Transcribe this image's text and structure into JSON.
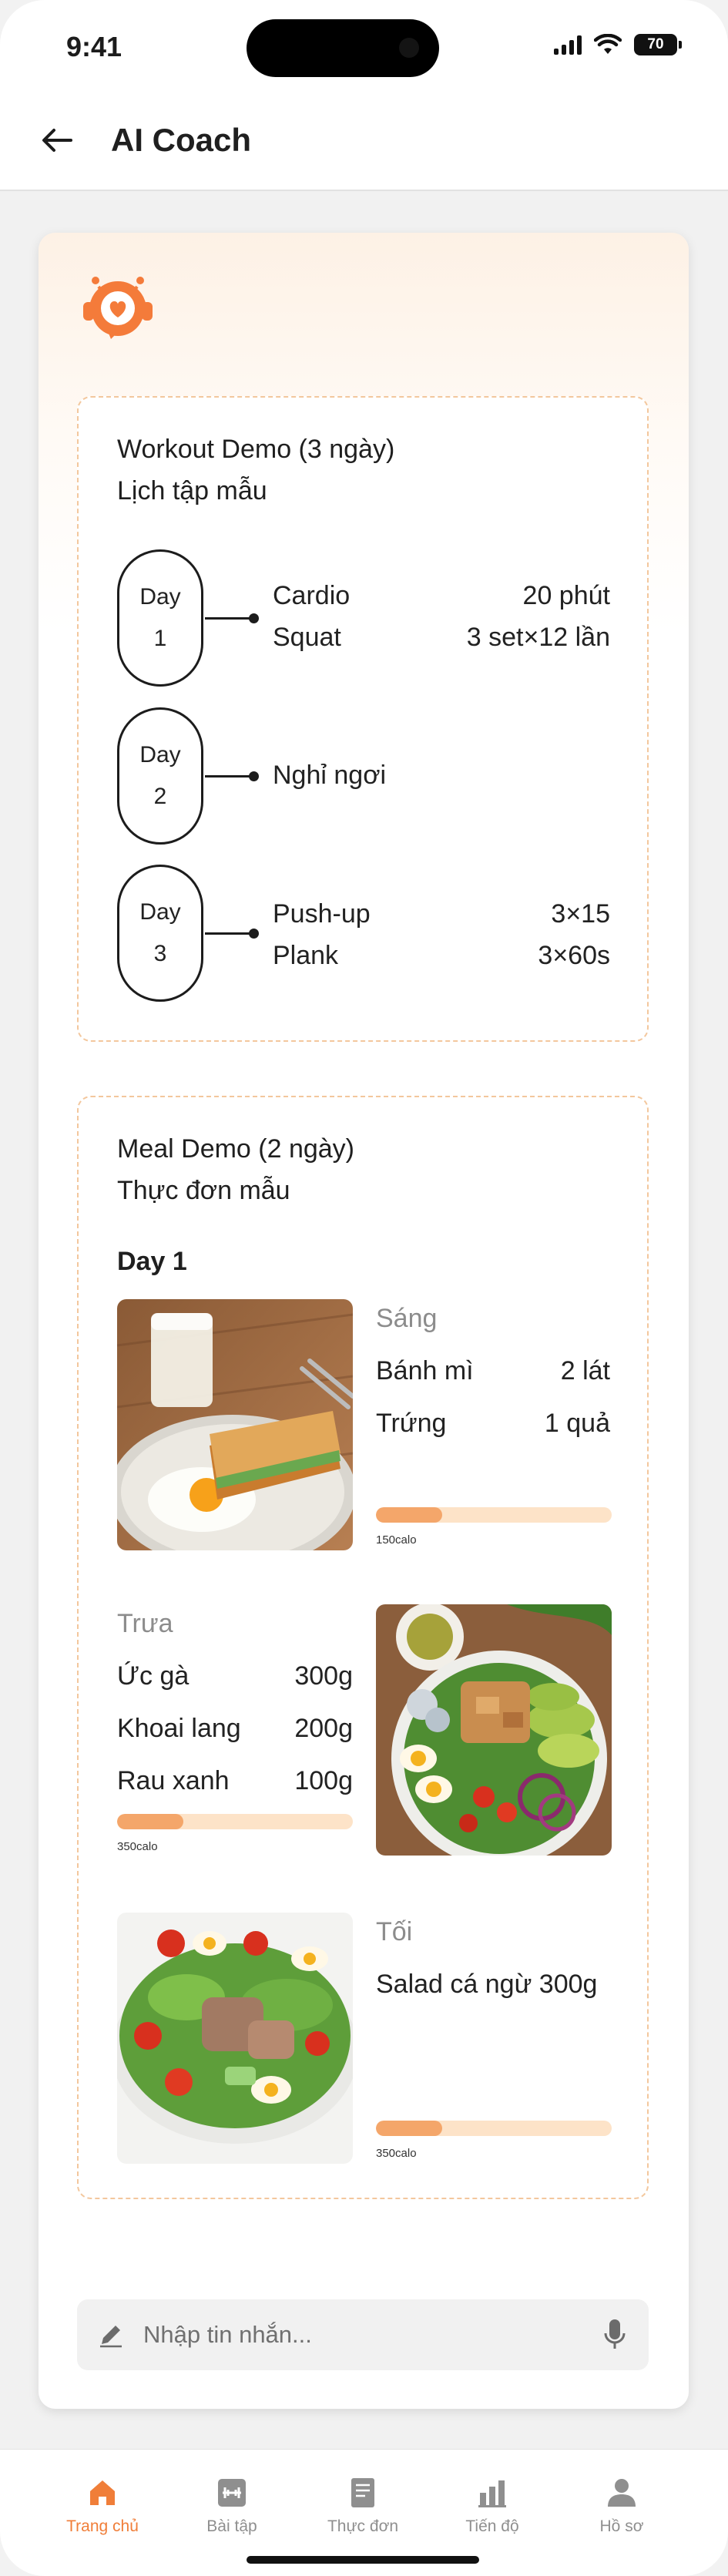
{
  "status_bar": {
    "time": "9:41",
    "battery": "70"
  },
  "header": {
    "title": "AI Coach"
  },
  "workout": {
    "title": "Workout Demo (3 ngày)",
    "subtitle": "Lịch tập mẫu",
    "days": [
      {
        "label": "Day",
        "num": "1",
        "items": [
          {
            "name": "Cardio",
            "value": "20 phút"
          },
          {
            "name": "Squat",
            "value": "3 set×12 lần"
          }
        ]
      },
      {
        "label": "Day",
        "num": "2",
        "items": [
          {
            "name": "Nghỉ ngơi",
            "value": ""
          }
        ]
      },
      {
        "label": "Day",
        "num": "3",
        "items": [
          {
            "name": "Push-up",
            "value": "3×15"
          },
          {
            "name": "Plank",
            "value": "3×60s"
          }
        ]
      }
    ]
  },
  "meal": {
    "title": "Meal Demo (2 ngày)",
    "subtitle": "Thực đơn mẫu",
    "day_label": "Day 1",
    "breakfast": {
      "heading": "Sáng",
      "items": [
        {
          "name": "Bánh mì",
          "qty": "2 lát"
        },
        {
          "name": "Trứng",
          "qty": "1 quả"
        }
      ],
      "calories": "150calo",
      "progress": 0.28
    },
    "lunch": {
      "heading": "Trưa",
      "items": [
        {
          "name": "Ức gà",
          "qty": "300g"
        },
        {
          "name": "Khoai lang",
          "qty": "200g"
        },
        {
          "name": "Rau xanh",
          "qty": "100g"
        }
      ],
      "calories": "350calo",
      "progress": 0.28
    },
    "dinner": {
      "heading": "Tối",
      "items": [
        {
          "name": "Salad cá ngừ 300g"
        }
      ],
      "calories": "350calo",
      "progress": 0.28
    }
  },
  "input": {
    "placeholder": "Nhập tin nhắn..."
  },
  "tabs": [
    {
      "label": "Trang chủ",
      "icon": "home-icon",
      "active": true
    },
    {
      "label": "Bài tập",
      "icon": "dumbbell-icon",
      "active": false
    },
    {
      "label": "Thực đơn",
      "icon": "menu-book-icon",
      "active": false
    },
    {
      "label": "Tiến độ",
      "icon": "bar-chart-icon",
      "active": false
    },
    {
      "label": "Hồ sơ",
      "icon": "profile-icon",
      "active": false
    }
  ],
  "colors": {
    "accent": "#f07e39",
    "progress_track": "#fde3c8",
    "progress_fill": "#f4a66a",
    "dashed_border": "#f3c79d"
  }
}
